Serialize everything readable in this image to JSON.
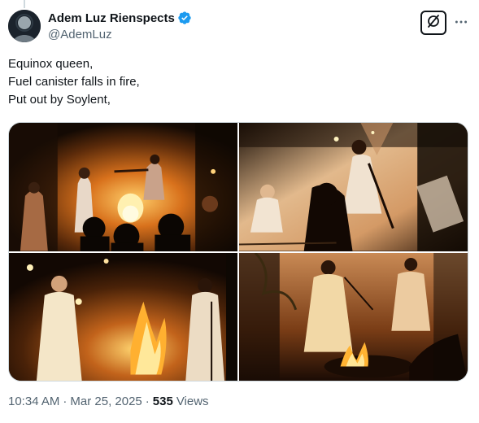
{
  "author": {
    "display_name": "Adem Luz Rienspects",
    "handle": "@AdemLuz",
    "verified": true,
    "avatar_icon": "profile-avatar"
  },
  "actions": {
    "grok_icon": "grok-icon",
    "more_icon": "more-dots-icon"
  },
  "tweet": {
    "lines": [
      "Equinox queen,",
      "Fuel canister falls in fire,",
      "Put out by Soylent,"
    ]
  },
  "media": {
    "count": 4,
    "photos": [
      "photo-performers-around-fire",
      "photo-singer-at-microphone",
      "photo-woman-in-white-flames",
      "photo-performers-at-fire-pit"
    ]
  },
  "meta": {
    "time": "10:34 AM",
    "separator": "·",
    "date": "Mar 25, 2025",
    "views_count": "535",
    "views_label": "Views"
  },
  "colors": {
    "verified_blue": "#1d9bf0",
    "secondary_text": "#536471",
    "border": "#cfd9de"
  }
}
